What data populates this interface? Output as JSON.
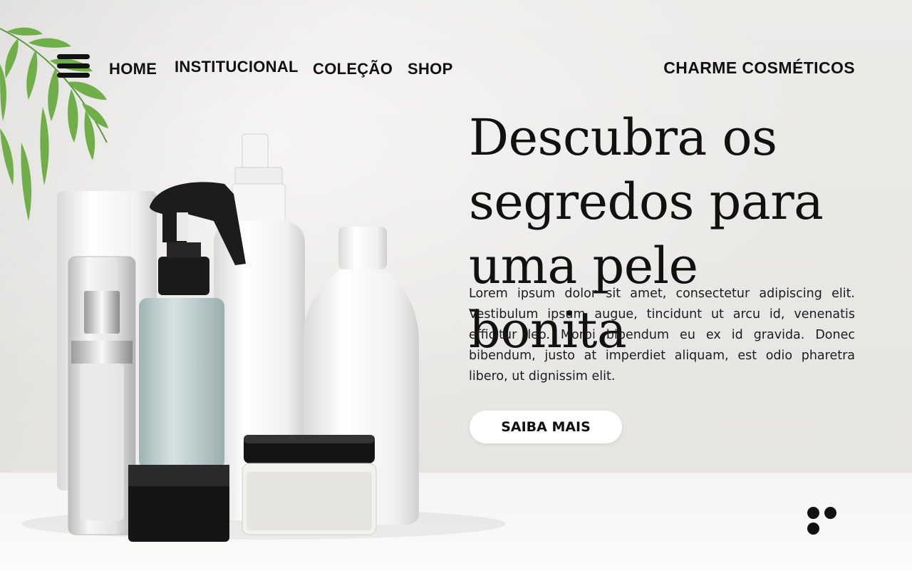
{
  "nav": {
    "menu_icon": "hamburger-menu-icon",
    "links": [
      "HOME",
      "INSTITUCIONAL",
      "COLEÇÃO",
      "SHOP"
    ],
    "brand": "CHARME COSMÉTICOS"
  },
  "hero": {
    "headline_line1": "Descubra os",
    "headline_line2": "segredos para",
    "headline_line3": "uma pele bonita",
    "body": "Lorem ipsum dolor sit amet, consectetur adipiscing elit. Vestibulum ipsum augue, tincidunt ut arcu id, venenatis efficitur leo. Morbi bibendum eu ex id gravida. Donec bibendum, justo at imperdiet aliquam, est odio pharetra libero, ut dignissim elit.",
    "cta_label": "SAIBA MAIS"
  },
  "pagination": {
    "icon": "more-dots-icon"
  },
  "colors": {
    "text": "#111111",
    "background": "#e9e9e6",
    "button_bg": "#ffffff"
  }
}
